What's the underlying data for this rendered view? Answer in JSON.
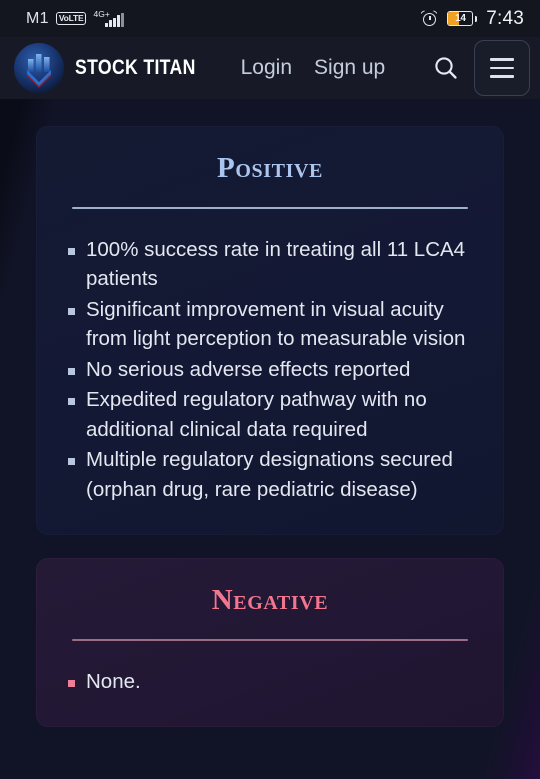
{
  "status_bar": {
    "carrier": "M1",
    "volte_badge": "VoLTE",
    "network_type": "4G+",
    "alarm_icon": "alarm-clock-icon",
    "battery_percent": "14",
    "time": "7:43"
  },
  "nav": {
    "brand_name": "STOCK TITAN",
    "logo_icon": "stock-titan-logo-icon",
    "links": [
      {
        "label": "Login",
        "name": "login-link"
      },
      {
        "label": "Sign up",
        "name": "signup-link"
      }
    ],
    "search_icon": "search-icon",
    "menu_icon": "hamburger-menu-icon"
  },
  "cards": [
    {
      "title": "Positive",
      "sentiment": "positive",
      "accent_color": "#aac6ee",
      "bullets": [
        "100% success rate in treating all 11 LCA4 patients",
        "Significant improvement in visual acuity from light perception to measurable vision",
        "No serious adverse effects reported",
        "Expedited regulatory pathway with no additional clinical data required",
        "Multiple regulatory designations secured (orphan drug, rare pediatric disease)"
      ]
    },
    {
      "title": "Negative",
      "sentiment": "negative",
      "accent_color": "#f2768f",
      "bullets": [
        "None."
      ]
    }
  ]
}
